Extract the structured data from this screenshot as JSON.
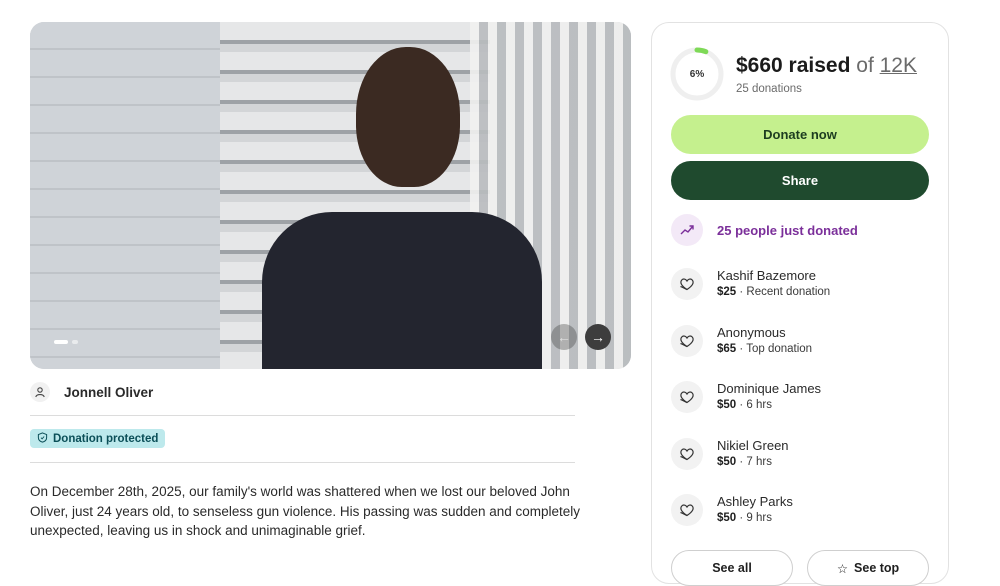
{
  "campaign": {
    "image_alt": "Young man in dark t-shirt standing by stairs",
    "slide_count": 2,
    "active_slide": 1
  },
  "organizer": {
    "name": "Jonnell Oliver",
    "icon": "person-icon"
  },
  "badge": {
    "label": "Donation protected",
    "icon": "shield-icon"
  },
  "story": {
    "text": "On December 28th, 2025, our family's world was shattered when we lost our beloved John Oliver, just 24 years old, to senseless gun violence. His passing was sudden and completely unexpected, leaving us in shock and unimaginable grief."
  },
  "progress": {
    "percent_label": "6%",
    "percent": 0.06,
    "raised": "$660 raised",
    "of": " of ",
    "goal": "12K",
    "donations_count": "25 donations",
    "accent_color": "#7ed957"
  },
  "actions": {
    "donate_label": "Donate now",
    "share_label": "Share"
  },
  "activity": {
    "label": "25 people just donated",
    "icon": "trending-up-icon",
    "color": "#7b2f9a"
  },
  "donors": [
    {
      "name": "Kashif Bazemore",
      "amount": "$25",
      "note": "Recent donation"
    },
    {
      "name": "Anonymous",
      "amount": "$65",
      "note": "Top donation"
    },
    {
      "name": "Dominique James",
      "amount": "$50",
      "note": "6 hrs"
    },
    {
      "name": "Nikiel Green",
      "amount": "$50",
      "note": "7 hrs"
    },
    {
      "name": "Ashley Parks",
      "amount": "$50",
      "note": "9 hrs"
    }
  ],
  "footer_buttons": {
    "see_all": "See all",
    "see_top": "See top"
  },
  "colors": {
    "donate_bg": "#c5f08e",
    "share_bg": "#1f4a2e",
    "badge_bg": "#bde9ec"
  }
}
